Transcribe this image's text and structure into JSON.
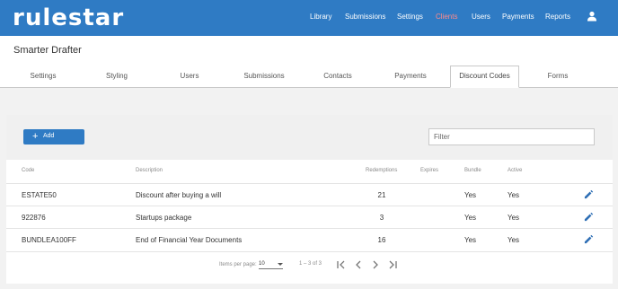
{
  "brand": "rulestar",
  "nav": {
    "items": [
      {
        "label": "Library"
      },
      {
        "label": "Submissions"
      },
      {
        "label": "Settings"
      },
      {
        "label": "Clients"
      },
      {
        "label": "Users"
      },
      {
        "label": "Payments"
      },
      {
        "label": "Reports"
      }
    ],
    "active": "Clients",
    "user_icon": "user-icon"
  },
  "page": {
    "title": "Smarter Drafter"
  },
  "tabs": [
    {
      "label": "Settings"
    },
    {
      "label": "Styling"
    },
    {
      "label": "Users"
    },
    {
      "label": "Submissions"
    },
    {
      "label": "Contacts"
    },
    {
      "label": "Payments"
    },
    {
      "label": "Discount Codes"
    },
    {
      "label": "Forms"
    }
  ],
  "active_tab": "Discount Codes",
  "toolbar": {
    "add_label": "Add",
    "filter_placeholder": "Filter"
  },
  "table": {
    "headers": {
      "code": "Code",
      "description": "Description",
      "redemptions": "Redemptions",
      "expires": "Expires",
      "bundle": "Bundle",
      "active": "Active"
    },
    "rows": [
      {
        "code": "ESTATE50",
        "description": "Discount after buying a will",
        "redemptions": "21",
        "expires": "",
        "bundle": "Yes",
        "active": "Yes"
      },
      {
        "code": "922876",
        "description": "Startups package",
        "redemptions": "3",
        "expires": "",
        "bundle": "Yes",
        "active": "Yes"
      },
      {
        "code": "BUNDLEA100FF",
        "description": "End of Financial Year Documents",
        "redemptions": "16",
        "expires": "",
        "bundle": "Yes",
        "active": "Yes"
      }
    ]
  },
  "pagination": {
    "items_per_page_label": "Items per page:",
    "items_per_page": "10",
    "range": "1 – 3 of 3"
  },
  "colors": {
    "accent": "#2f7bc4",
    "active_nav": "#ff8a8a",
    "edit_icon": "#2f6fb5"
  }
}
